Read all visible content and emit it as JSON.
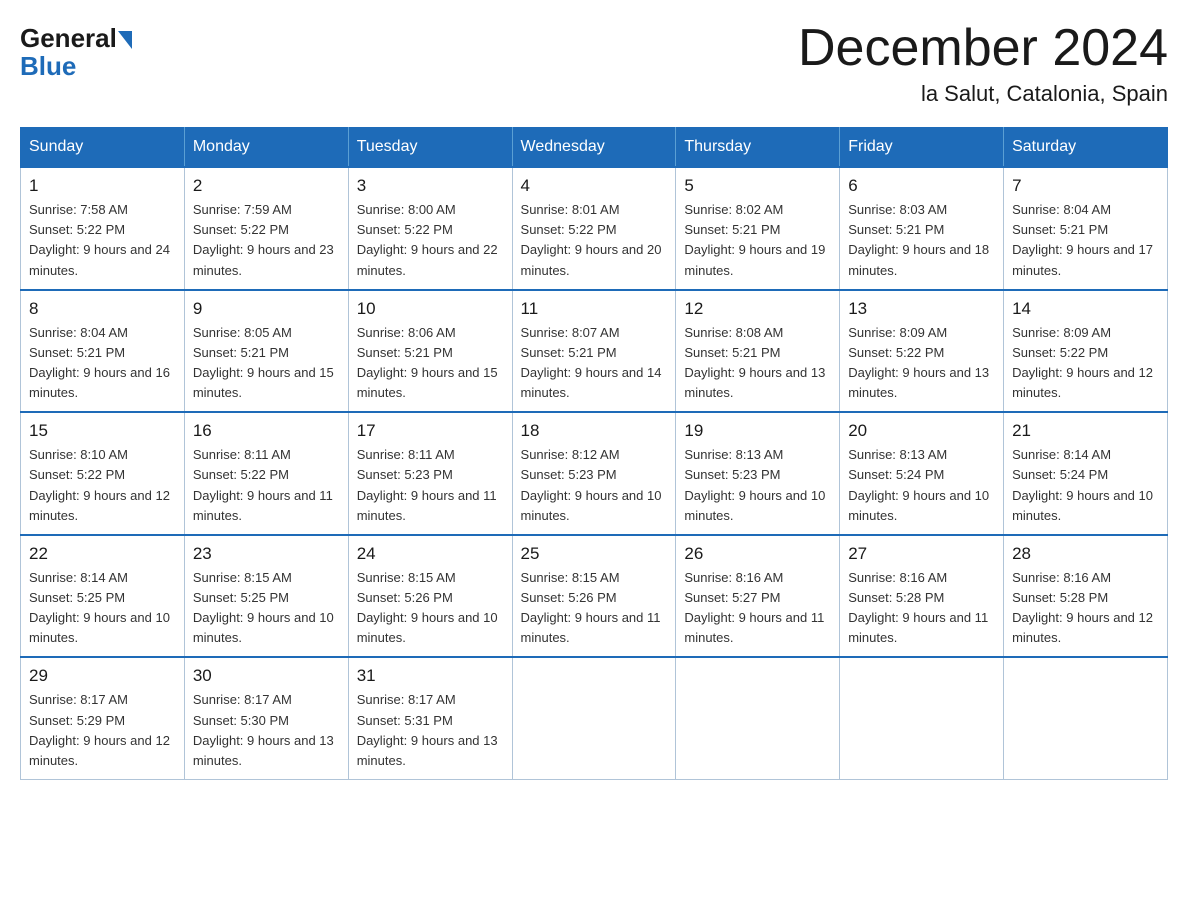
{
  "header": {
    "logo": {
      "general": "General",
      "blue": "Blue"
    },
    "title": "December 2024",
    "location": "la Salut, Catalonia, Spain"
  },
  "weekdays": [
    "Sunday",
    "Monday",
    "Tuesday",
    "Wednesday",
    "Thursday",
    "Friday",
    "Saturday"
  ],
  "weeks": [
    [
      {
        "day": "1",
        "sunrise": "7:58 AM",
        "sunset": "5:22 PM",
        "daylight": "9 hours and 24 minutes."
      },
      {
        "day": "2",
        "sunrise": "7:59 AM",
        "sunset": "5:22 PM",
        "daylight": "9 hours and 23 minutes."
      },
      {
        "day": "3",
        "sunrise": "8:00 AM",
        "sunset": "5:22 PM",
        "daylight": "9 hours and 22 minutes."
      },
      {
        "day": "4",
        "sunrise": "8:01 AM",
        "sunset": "5:22 PM",
        "daylight": "9 hours and 20 minutes."
      },
      {
        "day": "5",
        "sunrise": "8:02 AM",
        "sunset": "5:21 PM",
        "daylight": "9 hours and 19 minutes."
      },
      {
        "day": "6",
        "sunrise": "8:03 AM",
        "sunset": "5:21 PM",
        "daylight": "9 hours and 18 minutes."
      },
      {
        "day": "7",
        "sunrise": "8:04 AM",
        "sunset": "5:21 PM",
        "daylight": "9 hours and 17 minutes."
      }
    ],
    [
      {
        "day": "8",
        "sunrise": "8:04 AM",
        "sunset": "5:21 PM",
        "daylight": "9 hours and 16 minutes."
      },
      {
        "day": "9",
        "sunrise": "8:05 AM",
        "sunset": "5:21 PM",
        "daylight": "9 hours and 15 minutes."
      },
      {
        "day": "10",
        "sunrise": "8:06 AM",
        "sunset": "5:21 PM",
        "daylight": "9 hours and 15 minutes."
      },
      {
        "day": "11",
        "sunrise": "8:07 AM",
        "sunset": "5:21 PM",
        "daylight": "9 hours and 14 minutes."
      },
      {
        "day": "12",
        "sunrise": "8:08 AM",
        "sunset": "5:21 PM",
        "daylight": "9 hours and 13 minutes."
      },
      {
        "day": "13",
        "sunrise": "8:09 AM",
        "sunset": "5:22 PM",
        "daylight": "9 hours and 13 minutes."
      },
      {
        "day": "14",
        "sunrise": "8:09 AM",
        "sunset": "5:22 PM",
        "daylight": "9 hours and 12 minutes."
      }
    ],
    [
      {
        "day": "15",
        "sunrise": "8:10 AM",
        "sunset": "5:22 PM",
        "daylight": "9 hours and 12 minutes."
      },
      {
        "day": "16",
        "sunrise": "8:11 AM",
        "sunset": "5:22 PM",
        "daylight": "9 hours and 11 minutes."
      },
      {
        "day": "17",
        "sunrise": "8:11 AM",
        "sunset": "5:23 PM",
        "daylight": "9 hours and 11 minutes."
      },
      {
        "day": "18",
        "sunrise": "8:12 AM",
        "sunset": "5:23 PM",
        "daylight": "9 hours and 10 minutes."
      },
      {
        "day": "19",
        "sunrise": "8:13 AM",
        "sunset": "5:23 PM",
        "daylight": "9 hours and 10 minutes."
      },
      {
        "day": "20",
        "sunrise": "8:13 AM",
        "sunset": "5:24 PM",
        "daylight": "9 hours and 10 minutes."
      },
      {
        "day": "21",
        "sunrise": "8:14 AM",
        "sunset": "5:24 PM",
        "daylight": "9 hours and 10 minutes."
      }
    ],
    [
      {
        "day": "22",
        "sunrise": "8:14 AM",
        "sunset": "5:25 PM",
        "daylight": "9 hours and 10 minutes."
      },
      {
        "day": "23",
        "sunrise": "8:15 AM",
        "sunset": "5:25 PM",
        "daylight": "9 hours and 10 minutes."
      },
      {
        "day": "24",
        "sunrise": "8:15 AM",
        "sunset": "5:26 PM",
        "daylight": "9 hours and 10 minutes."
      },
      {
        "day": "25",
        "sunrise": "8:15 AM",
        "sunset": "5:26 PM",
        "daylight": "9 hours and 11 minutes."
      },
      {
        "day": "26",
        "sunrise": "8:16 AM",
        "sunset": "5:27 PM",
        "daylight": "9 hours and 11 minutes."
      },
      {
        "day": "27",
        "sunrise": "8:16 AM",
        "sunset": "5:28 PM",
        "daylight": "9 hours and 11 minutes."
      },
      {
        "day": "28",
        "sunrise": "8:16 AM",
        "sunset": "5:28 PM",
        "daylight": "9 hours and 12 minutes."
      }
    ],
    [
      {
        "day": "29",
        "sunrise": "8:17 AM",
        "sunset": "5:29 PM",
        "daylight": "9 hours and 12 minutes."
      },
      {
        "day": "30",
        "sunrise": "8:17 AM",
        "sunset": "5:30 PM",
        "daylight": "9 hours and 13 minutes."
      },
      {
        "day": "31",
        "sunrise": "8:17 AM",
        "sunset": "5:31 PM",
        "daylight": "9 hours and 13 minutes."
      },
      null,
      null,
      null,
      null
    ]
  ]
}
